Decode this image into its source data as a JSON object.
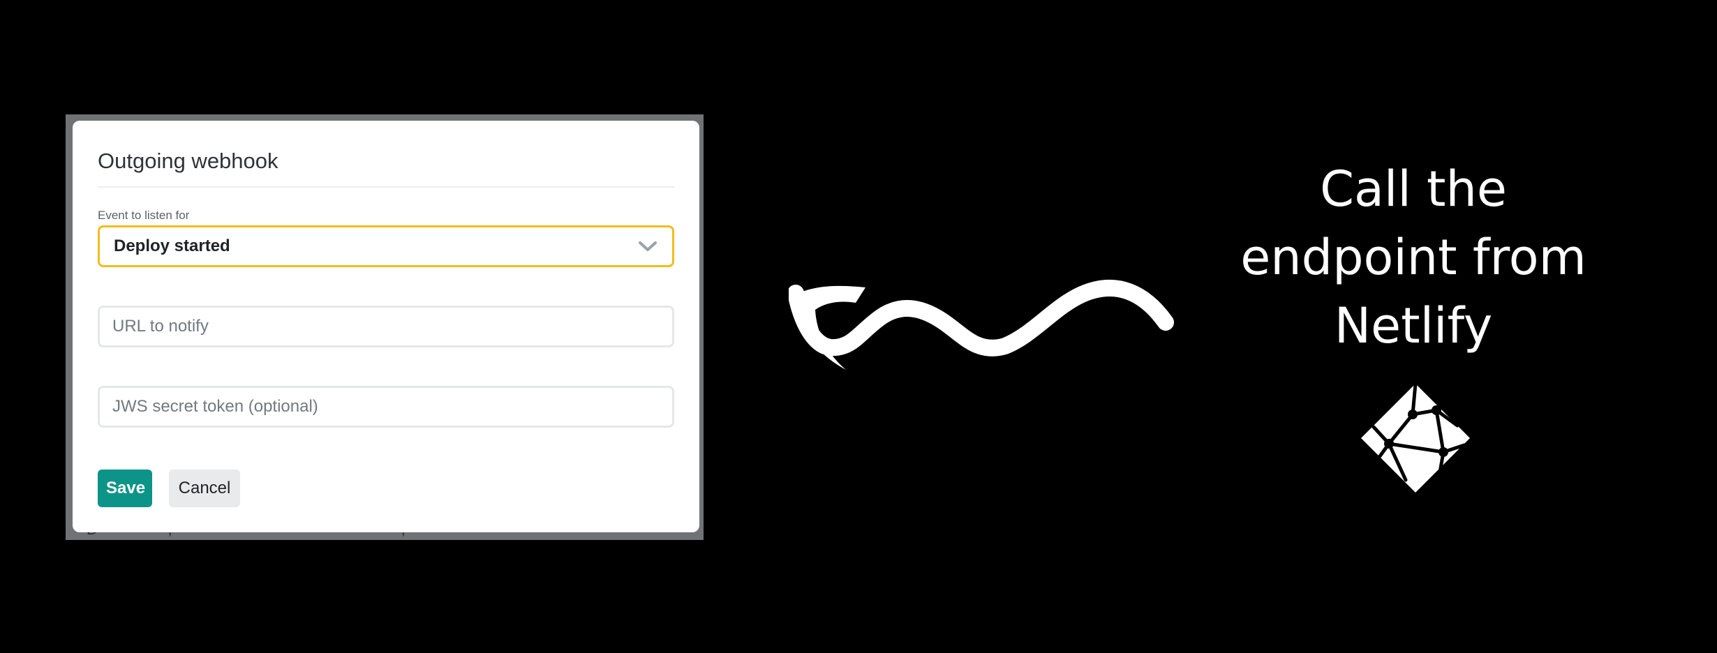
{
  "modal": {
    "title": "Outgoing webhook",
    "event_label": "Event to listen for",
    "event_selected": "Deploy started",
    "url_placeholder": "URL to notify",
    "jws_placeholder": "JWS secret token (optional)",
    "save_label": "Save",
    "cancel_label": "Cancel"
  },
  "caption": {
    "line1": "Call the",
    "line2": "endpoint from",
    "line3": "Netlify"
  },
  "icons": {
    "select_chevron": "chevron-down-icon",
    "arrow": "squiggly-arrow-icon",
    "brand_logo": "netlify-logo"
  },
  "colors": {
    "background": "#000000",
    "select_border": "#f2bc1c",
    "save_button": "#0d9488",
    "cancel_button": "#e8eaeb",
    "caption_text": "#ffffff"
  }
}
